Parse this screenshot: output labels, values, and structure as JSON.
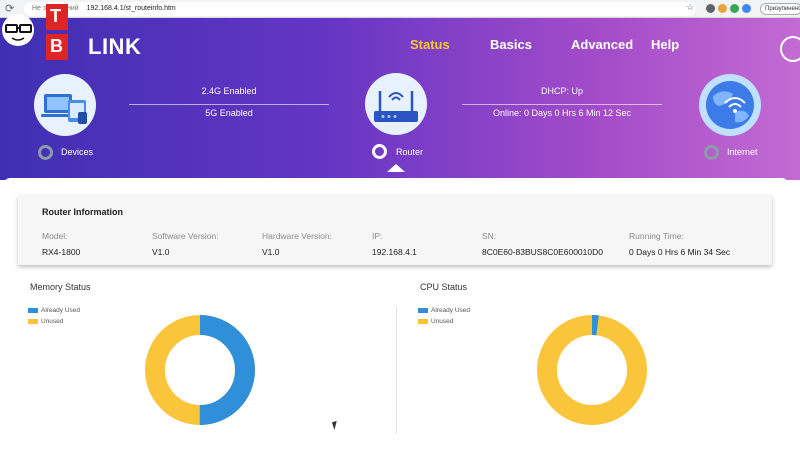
{
  "browser": {
    "security_text": "Не захищений",
    "url": "192.168.4.1/st_routeinfo.htm",
    "profile_label": "Призупинено"
  },
  "header": {
    "logo_text": "LINK",
    "nav": [
      "Status",
      "Basics",
      "Advanced",
      "Help"
    ],
    "active_nav": "Status",
    "accent_color": "#f7c733"
  },
  "topology": {
    "devices_label": "Devices",
    "router_label": "Router",
    "internet_label": "Internet",
    "wifi_24": "2.4G Enabled",
    "wifi_5": "5G Enabled",
    "dhcp": "DHCP: Up",
    "online": "Online: 0 Days 0 Hrs 6 Min 12 Sec"
  },
  "router_info": {
    "title": "Router Information",
    "fields": [
      {
        "key": "Model:",
        "value": "RX4-1800"
      },
      {
        "key": "Software Version:",
        "value": "V1.0"
      },
      {
        "key": "Hardware Version:",
        "value": "V1.0"
      },
      {
        "key": "IP:",
        "value": "192.168.4.1"
      },
      {
        "key": "SN:",
        "value": "8C0E60-83BUS8C0E600010D0"
      },
      {
        "key": "Running Time:",
        "value": "0 Days 0 Hrs 6 Min 34 Sec"
      }
    ]
  },
  "memory": {
    "title": "Memory Status",
    "legend_used": "Already Used",
    "legend_unused": "Unused",
    "used_fraction": 0.5
  },
  "cpu": {
    "title": "CPU Status",
    "legend_used": "Already Used",
    "legend_unused": "Unused",
    "used_fraction": 0.02
  },
  "colors": {
    "used": "#2f8fd8",
    "unused": "#fbc53b"
  },
  "watermark": {
    "letter_top": "T",
    "letter_bottom": "B"
  }
}
